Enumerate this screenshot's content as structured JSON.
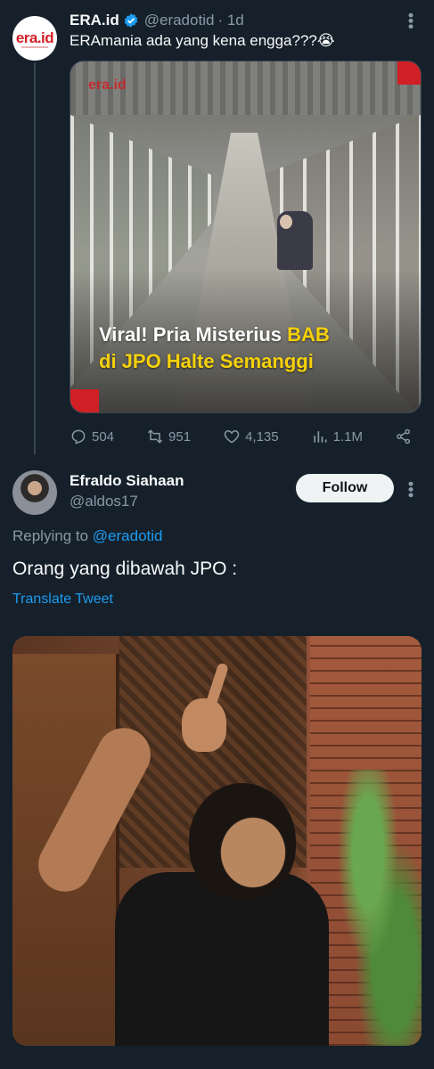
{
  "tweet1": {
    "author_name": "ERA.id",
    "avatar_text": "era.id",
    "handle": "@eradotid",
    "time": "· 1d",
    "text": "ERAmania ada yang kena engga???😭",
    "media": {
      "watermark": "era.id",
      "headline_white_1": "Viral! Pria Misterius ",
      "headline_yellow": "BAB",
      "headline_yellow_2": "di JPO Halte Semanggi"
    },
    "stats": {
      "replies": "504",
      "retweets": "951",
      "likes": "4,135",
      "views": "1.1M"
    }
  },
  "tweet2": {
    "author_name": "Efraldo Siahaan",
    "handle": "@aldos17",
    "follow_label": "Follow",
    "replying_prefix": "Replying to ",
    "replying_to": "@eradotid",
    "text": "Orang yang dibawah JPO :",
    "translate_label": "Translate Tweet"
  },
  "colors": {
    "background": "#15202b",
    "accent": "#1d9bf0",
    "muted": "#8b98a5",
    "headline_highlight": "#f5d10a",
    "era_red": "#d01f25"
  }
}
